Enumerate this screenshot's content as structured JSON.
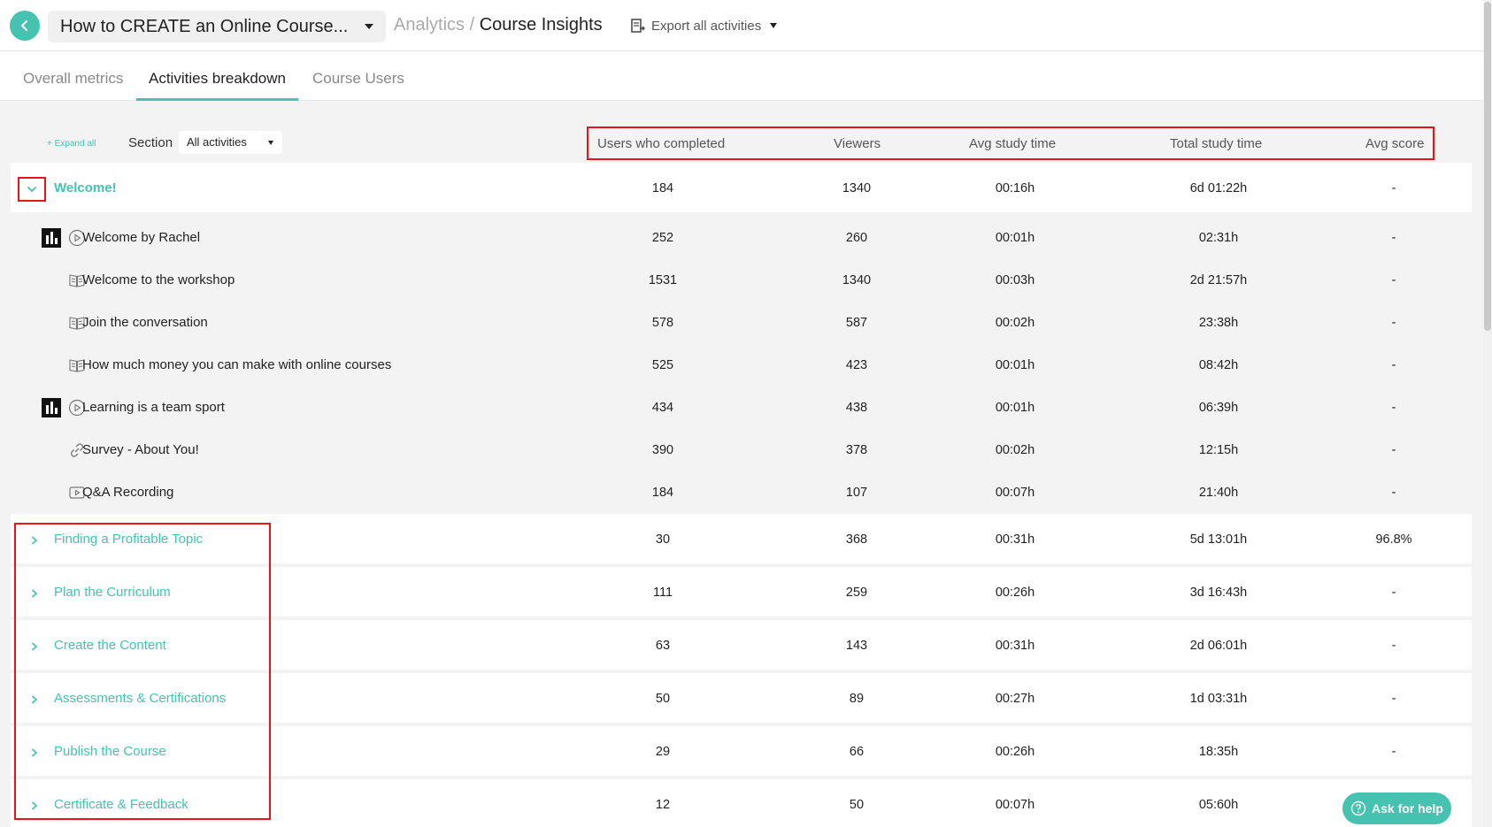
{
  "header": {
    "course_title": "How to CREATE an Online Course...",
    "breadcrumb_parent": "Analytics /",
    "breadcrumb_current": "Course Insights",
    "export_label": "Export all activities"
  },
  "tabs": [
    {
      "label": "Overall metrics",
      "active": false
    },
    {
      "label": "Activities breakdown",
      "active": true
    },
    {
      "label": "Course Users",
      "active": false
    }
  ],
  "controls": {
    "expand_all": "+ Expand all",
    "section_label": "Section",
    "section_value": "All activities"
  },
  "columns": [
    "Users who completed",
    "Viewers",
    "Avg study time",
    "Total study time",
    "Avg score"
  ],
  "welcome_section": {
    "title": "Welcome!",
    "values": [
      "184",
      "1340",
      "00:16h",
      "6d 01:22h",
      "-"
    ]
  },
  "activities": [
    {
      "title": "Welcome by Rachel",
      "icon": "play-circle-icon",
      "stats": true,
      "values": [
        "252",
        "260",
        "00:01h",
        "02:31h",
        "-"
      ]
    },
    {
      "title": "Welcome to the workshop",
      "icon": "book-icon",
      "stats": false,
      "values": [
        "1531",
        "1340",
        "00:03h",
        "2d 21:57h",
        "-"
      ]
    },
    {
      "title": "Join the conversation",
      "icon": "book-icon",
      "stats": false,
      "values": [
        "578",
        "587",
        "00:02h",
        "23:38h",
        "-"
      ]
    },
    {
      "title": "How much money you can make with online courses",
      "icon": "book-icon",
      "stats": false,
      "values": [
        "525",
        "423",
        "00:01h",
        "08:42h",
        "-"
      ]
    },
    {
      "title": "Learning is a team sport",
      "icon": "play-circle-icon",
      "stats": true,
      "values": [
        "434",
        "438",
        "00:01h",
        "06:39h",
        "-"
      ]
    },
    {
      "title": "Survey - About You!",
      "icon": "link-icon",
      "stats": false,
      "values": [
        "390",
        "378",
        "00:02h",
        "12:15h",
        "-"
      ]
    },
    {
      "title": "Q&A Recording",
      "icon": "video-icon",
      "stats": false,
      "values": [
        "184",
        "107",
        "00:07h",
        "21:40h",
        "-"
      ]
    }
  ],
  "sections": [
    {
      "title": "Finding a Profitable Topic",
      "values": [
        "30",
        "368",
        "00:31h",
        "5d 13:01h",
        "96.8%"
      ]
    },
    {
      "title": "Plan the Curriculum",
      "values": [
        "111",
        "259",
        "00:26h",
        "3d 16:43h",
        "-"
      ]
    },
    {
      "title": "Create the Content",
      "values": [
        "63",
        "143",
        "00:31h",
        "2d 06:01h",
        "-"
      ]
    },
    {
      "title": "Assessments & Certifications",
      "values": [
        "50",
        "89",
        "00:27h",
        "1d 03:31h",
        "-"
      ]
    },
    {
      "title": "Publish the Course",
      "values": [
        "29",
        "66",
        "00:26h",
        "18:35h",
        "-"
      ]
    },
    {
      "title": "Certificate & Feedback",
      "values": [
        "12",
        "50",
        "00:07h",
        "05:60h",
        ""
      ]
    }
  ],
  "help": {
    "label": "Ask for help"
  },
  "colors": {
    "accent": "#46c2b0",
    "highlight": "#e8141a"
  }
}
